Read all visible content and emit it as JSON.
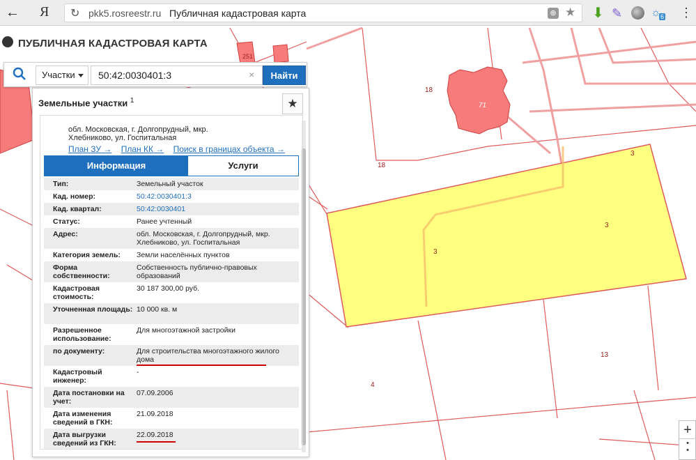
{
  "browser": {
    "url_domain": "pkk5.rosreestr.ru",
    "tab_title": "Публичная кадастровая карта",
    "logo": "Я",
    "back_icon": "←",
    "reload_icon": "↻",
    "star_icon": "★",
    "menu_icon": "⋮",
    "weather_badge": "6"
  },
  "app": {
    "title": "ПУБЛИЧНАЯ КАДАСТРОВАЯ КАРТА"
  },
  "search": {
    "type_label": "Участки",
    "value": "50:42:0030401:3",
    "clear": "×",
    "button_label": "Найти"
  },
  "panel": {
    "heading": "Земельные участки",
    "heading_count": "1",
    "address_head_1": "обл. Московская, г. Долгопрудный, мкр.",
    "address_head_2": "Хлебниково, ул. Госпитальная",
    "links": [
      "План ЗУ →",
      "План КК →",
      "Поиск в границах объекта →"
    ],
    "tabs": {
      "info": "Информация",
      "services": "Услуги"
    },
    "rows": [
      {
        "label": "Тип:",
        "value": "Земельный участок"
      },
      {
        "label": "Кад. номер:",
        "value": "50:42:0030401:3"
      },
      {
        "label": "Кад. квартал:",
        "value": "50:42:0030401"
      },
      {
        "label": "Статус:",
        "value": "Ранее учтенный"
      },
      {
        "label": "Адрес:",
        "value": "обл. Московская, г. Долгопрудный, мкр. Хлебниково, ул. Госпитальная"
      },
      {
        "label": "Категория земель:",
        "value": "Земли населённых пунктов"
      },
      {
        "label": "Форма собственности:",
        "value": "Собственность публично-правовых образований"
      },
      {
        "label": "Кадастровая стоимость:",
        "value": "30 187 300,00 руб."
      },
      {
        "label": "Уточненная площадь:",
        "value": "10 000 кв. м"
      },
      {
        "label": "Разрешенное использование:",
        "value": "Для многоэтажной застройки"
      },
      {
        "label": "по документу:",
        "value": "Для строительства многоэтажного жилого дома"
      },
      {
        "label": "Кадастровый инженер:",
        "value": "-"
      },
      {
        "label": "Дата постановки на учет:",
        "value": "07.09.2006"
      },
      {
        "label": "Дата изменения сведений в ГКН:",
        "value": "21.09.2018"
      },
      {
        "label": "Дата выгрузки сведений из ГКН:",
        "value": "22.09.2018"
      }
    ]
  },
  "map": {
    "labels": [
      "18",
      "71",
      "18",
      "3",
      "3",
      "3",
      "13",
      "4",
      "251"
    ],
    "parcel_color": "#ffff80",
    "building_color": "#f77b7b",
    "line_color": "#e05a5a"
  },
  "zoom": {
    "plus": "+",
    "dots": "•\n•"
  }
}
